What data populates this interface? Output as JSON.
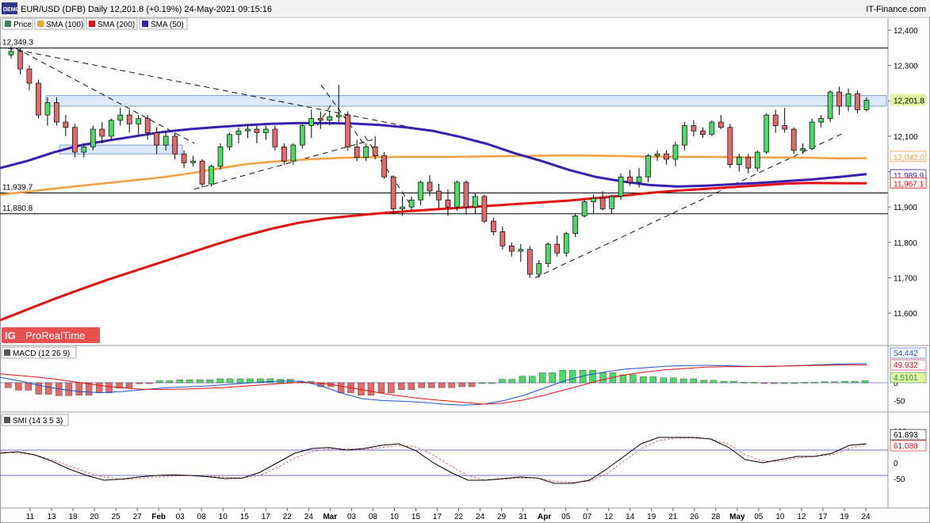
{
  "header": {
    "badge": "DEMO",
    "title": "EUR/USD (DFB) Daily 12,201.8 (+0.19%) 24-May-2021 09:15:16",
    "brand": "IT-Finance.com"
  },
  "legend": [
    {
      "label": "Price",
      "color": "#2e8b57"
    },
    {
      "label": "SMA (100)",
      "color": "#f5a040"
    },
    {
      "label": "SMA (200)",
      "color": "#e31010"
    },
    {
      "label": "SMA (50)",
      "color": "#3a1fb0"
    }
  ],
  "watermark": "ProRealTime",
  "x_labels": [
    "11",
    "13",
    "18",
    "20",
    "25",
    "27",
    "Feb",
    "03",
    "08",
    "10",
    "15",
    "17",
    "22",
    "24",
    "Mar",
    "03",
    "08",
    "10",
    "15",
    "17",
    "22",
    "24",
    "29",
    "31",
    "Apr",
    "05",
    "07",
    "12",
    "14",
    "19",
    "21",
    "26",
    "28",
    "May",
    "05",
    "10",
    "12",
    "17",
    "19",
    "24"
  ],
  "bold_labels": [
    "Feb",
    "Mar",
    "Apr",
    "May"
  ],
  "price_axis": {
    "ticks": [
      "12,400",
      "12,300",
      "12,200",
      "12,100",
      "12,000",
      "11,900",
      "11,800",
      "11,700",
      "11,600"
    ],
    "flags": [
      {
        "text": "12,201.8",
        "value": 12201.8,
        "bg": "#dff5a0",
        "fg": "#000000"
      },
      {
        "text": "12,042.0",
        "value": 12042.0,
        "bg": "#ffffff",
        "fg": "#f5a040"
      },
      {
        "text": "11,989.9",
        "value": 11989.9,
        "bg": "#ffffff",
        "fg": "#3a1fb0"
      },
      {
        "text": "11,967.1",
        "value": 11967.1,
        "bg": "#ffffff",
        "fg": "#e31010"
      }
    ],
    "levels": [
      {
        "text": "12,349.3",
        "value": 12349.3
      },
      {
        "text": "11,939.7",
        "value": 11939.7
      },
      {
        "text": "11,880.8",
        "value": 11880.8
      }
    ]
  },
  "macd": {
    "label": "MACD (12 26 9)",
    "ticks": [
      "50",
      "0",
      "-50"
    ],
    "flags": [
      {
        "text": "54.442",
        "color": "#2050d0"
      },
      {
        "text": "49.932",
        "color": "#e31010"
      },
      {
        "text": "4.5101",
        "color": "#2e8b57"
      }
    ]
  },
  "smi": {
    "label": "SMI (14 3 5 3)",
    "ticks": [
      "100",
      "50",
      "0",
      "-50"
    ],
    "flags": [
      {
        "text": "61.893",
        "color": "#000000"
      },
      {
        "text": "61.088",
        "color": "#e31010"
      }
    ]
  },
  "chart_data": {
    "type": "candlestick",
    "title": "EUR/USD (DFB) Daily 12,201.8 (+0.19%) 24-May-2021 09:15:16",
    "ylim": [
      11550,
      12450
    ],
    "candles": [
      [
        12330,
        12355,
        12320,
        12340
      ],
      [
        12340,
        12350,
        12275,
        12290
      ],
      [
        12290,
        12300,
        12230,
        12250
      ],
      [
        12250,
        12260,
        12150,
        12160
      ],
      [
        12160,
        12210,
        12130,
        12195
      ],
      [
        12195,
        12210,
        12130,
        12140
      ],
      [
        12140,
        12160,
        12100,
        12125
      ],
      [
        12125,
        12135,
        12040,
        12055
      ],
      [
        12055,
        12080,
        12040,
        12070
      ],
      [
        12070,
        12130,
        12060,
        12120
      ],
      [
        12120,
        12140,
        12080,
        12100
      ],
      [
        12100,
        12150,
        12090,
        12145
      ],
      [
        12145,
        12180,
        12130,
        12160
      ],
      [
        12160,
        12175,
        12110,
        12135
      ],
      [
        12135,
        12160,
        12100,
        12150
      ],
      [
        12150,
        12160,
        12090,
        12110
      ],
      [
        12110,
        12125,
        12050,
        12075
      ],
      [
        12075,
        12115,
        12060,
        12100
      ],
      [
        12100,
        12110,
        12035,
        12050
      ],
      [
        12050,
        12060,
        12010,
        12025
      ],
      [
        12025,
        12045,
        12015,
        12030
      ],
      [
        12030,
        12035,
        11955,
        11965
      ],
      [
        11965,
        12020,
        11958,
        12015
      ],
      [
        12015,
        12080,
        12005,
        12070
      ],
      [
        12070,
        12110,
        12060,
        12105
      ],
      [
        12105,
        12125,
        12080,
        12115
      ],
      [
        12115,
        12135,
        12095,
        12120
      ],
      [
        12120,
        12130,
        12080,
        12110
      ],
      [
        12110,
        12130,
        12090,
        12120
      ],
      [
        12120,
        12130,
        12060,
        12070
      ],
      [
        12070,
        12080,
        12020,
        12030
      ],
      [
        12030,
        12080,
        12020,
        12075
      ],
      [
        12075,
        12140,
        12065,
        12130
      ],
      [
        12130,
        12175,
        12095,
        12150
      ],
      [
        12150,
        12170,
        12120,
        12145
      ],
      [
        12145,
        12170,
        12130,
        12155
      ],
      [
        12155,
        12245,
        12140,
        12160
      ],
      [
        12160,
        12170,
        12060,
        12070
      ],
      [
        12070,
        12090,
        12030,
        12040
      ],
      [
        12040,
        12080,
        12030,
        12070
      ],
      [
        12070,
        12100,
        12035,
        12045
      ],
      [
        12045,
        12055,
        11980,
        11985
      ],
      [
        11985,
        11990,
        11880,
        11895
      ],
      [
        11895,
        11930,
        11875,
        11900
      ],
      [
        11900,
        11930,
        11890,
        11920
      ],
      [
        11920,
        11975,
        11905,
        11970
      ],
      [
        11970,
        11990,
        11930,
        11945
      ],
      [
        11945,
        11965,
        11895,
        11920
      ],
      [
        11920,
        11950,
        11875,
        11900
      ],
      [
        11900,
        11975,
        11890,
        11970
      ],
      [
        11970,
        11975,
        11880,
        11900
      ],
      [
        11900,
        11940,
        11880,
        11930
      ],
      [
        11930,
        11935,
        11855,
        11860
      ],
      [
        11860,
        11870,
        11820,
        11830
      ],
      [
        11830,
        11845,
        11780,
        11790
      ],
      [
        11790,
        11800,
        11760,
        11775
      ],
      [
        11775,
        11795,
        11745,
        11780
      ],
      [
        11780,
        11790,
        11700,
        11710
      ],
      [
        11710,
        11750,
        11700,
        11740
      ],
      [
        11740,
        11800,
        11730,
        11795
      ],
      [
        11795,
        11820,
        11760,
        11770
      ],
      [
        11770,
        11830,
        11760,
        11825
      ],
      [
        11825,
        11880,
        11815,
        11875
      ],
      [
        11875,
        11920,
        11870,
        11915
      ],
      [
        11915,
        11935,
        11880,
        11925
      ],
      [
        11925,
        11945,
        11890,
        11895
      ],
      [
        11895,
        11935,
        11880,
        11930
      ],
      [
        11930,
        11995,
        11920,
        11985
      ],
      [
        11985,
        12005,
        11960,
        11970
      ],
      [
        11970,
        12010,
        11955,
        11985
      ],
      [
        11985,
        12050,
        11970,
        12045
      ],
      [
        12045,
        12060,
        12030,
        12050
      ],
      [
        12050,
        12060,
        12020,
        12035
      ],
      [
        12035,
        12085,
        12015,
        12075
      ],
      [
        12075,
        12140,
        12060,
        12130
      ],
      [
        12130,
        12145,
        12100,
        12115
      ],
      [
        12115,
        12125,
        12095,
        12105
      ],
      [
        12105,
        12145,
        12100,
        12140
      ],
      [
        12140,
        12160,
        12120,
        12125
      ],
      [
        12125,
        12135,
        12010,
        12020
      ],
      [
        12020,
        12050,
        12000,
        12040
      ],
      [
        12040,
        12050,
        11995,
        12010
      ],
      [
        12010,
        12060,
        12000,
        12055
      ],
      [
        12055,
        12165,
        12050,
        12160
      ],
      [
        12160,
        12175,
        12110,
        12130
      ],
      [
        12130,
        12180,
        12110,
        12120
      ],
      [
        12120,
        12125,
        12050,
        12060
      ],
      [
        12060,
        12080,
        12050,
        12065
      ],
      [
        12065,
        12150,
        12060,
        12140
      ],
      [
        12140,
        12160,
        12125,
        12150
      ],
      [
        12150,
        12230,
        12140,
        12225
      ],
      [
        12225,
        12240,
        12160,
        12185
      ],
      [
        12185,
        12235,
        12170,
        12220
      ],
      [
        12220,
        12230,
        12165,
        12175
      ],
      [
        12175,
        12210,
        12170,
        12201.8
      ]
    ],
    "sma50": [
      12010,
      12030,
      12055,
      12075,
      12088,
      12100,
      12112,
      12120,
      12126,
      12131,
      12135,
      12137,
      12137,
      12136,
      12132,
      12125,
      12115,
      12098,
      12078,
      12052,
      12030,
      12005,
      11985,
      11972,
      11962,
      11958,
      11960,
      11964,
      11968,
      11973,
      11978,
      11985,
      11993
    ],
    "sma100": [
      11935,
      11943,
      11952,
      11960,
      11968,
      11976,
      11984,
      11995,
      12008,
      12020,
      12028,
      12033,
      12037,
      12040,
      12041,
      12042,
      12042,
      12042,
      12043,
      12044,
      12045,
      12046,
      12045,
      12044,
      12042,
      12042,
      12042,
      12041,
      12040,
      12040,
      12039,
      12037,
      12038
    ],
    "sma200": [
      11580,
      11610,
      11640,
      11668,
      11695,
      11720,
      11745,
      11770,
      11795,
      11818,
      11838,
      11855,
      11867,
      11875,
      11882,
      11888,
      11893,
      11898,
      11903,
      11908,
      11913,
      11918,
      11925,
      11932,
      11940,
      11946,
      11951,
      11956,
      11961,
      11966,
      11968,
      11967,
      11967
    ]
  }
}
